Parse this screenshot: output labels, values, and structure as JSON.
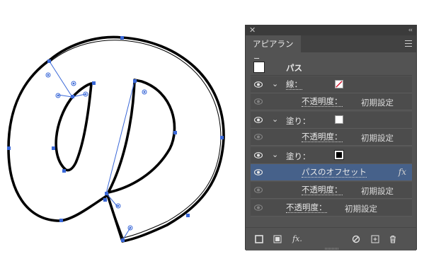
{
  "panel": {
    "tab_label": "アピアランス",
    "header_label": "パス",
    "rows": [
      {
        "label": "線：",
        "opacity_label": "不透明度：",
        "opacity_value": "初期設定"
      },
      {
        "label": "塗り：",
        "opacity_label": "不透明度：",
        "opacity_value": "初期設定"
      },
      {
        "label": "塗り：",
        "effect_label": "パスのオフセット",
        "effect_fx": "fx",
        "opacity_label": "不透明度：",
        "opacity_value": "初期設定"
      }
    ],
    "object_opacity_label": "不透明度：",
    "object_opacity_value": "初期設定",
    "bottom_fx": "fx."
  },
  "colors": {
    "panel_bg": "#535353",
    "selected_row": "#46618a",
    "path_anchor": "#3a68d8",
    "stroke_swatch_line": "#d0021b"
  },
  "icons": [
    "close-icon",
    "collapse-icon",
    "menu-icon",
    "eye-icon",
    "chevron-down-icon",
    "add-new-stroke-icon",
    "add-new-fill-icon",
    "add-effect-icon",
    "clear-appearance-icon",
    "duplicate-item-icon",
    "delete-icon"
  ]
}
